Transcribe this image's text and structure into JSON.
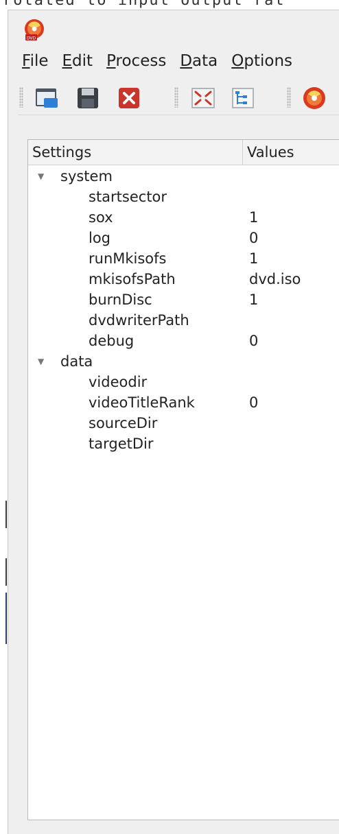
{
  "background_partial_text": "rotated to input output rat",
  "app": {
    "icon": "dvd-disc-icon",
    "icon_badge_text": "DVD"
  },
  "menubar": {
    "items": [
      {
        "label": "File"
      },
      {
        "label": "Edit"
      },
      {
        "label": "Process"
      },
      {
        "label": "Data"
      },
      {
        "label": "Options"
      }
    ]
  },
  "toolbar": {
    "buttons": [
      {
        "name": "open-window-icon"
      },
      {
        "name": "save-icon"
      },
      {
        "name": "close-red-x-icon"
      },
      {
        "name": "expand-tree-icon"
      },
      {
        "name": "collapse-tree-icon"
      },
      {
        "name": "burn-disc-icon"
      }
    ]
  },
  "tree": {
    "headers": {
      "settings": "Settings",
      "values": "Values"
    },
    "groups": [
      {
        "label": "system",
        "children": [
          {
            "key": "startsector",
            "value": ""
          },
          {
            "key": "sox",
            "value": "1"
          },
          {
            "key": "log",
            "value": "0"
          },
          {
            "key": "runMkisofs",
            "value": "1"
          },
          {
            "key": "mkisofsPath",
            "value": "dvd.iso"
          },
          {
            "key": "burnDisc",
            "value": "1"
          },
          {
            "key": "dvdwriterPath",
            "value": ""
          },
          {
            "key": "debug",
            "value": "0"
          }
        ]
      },
      {
        "label": "data",
        "children": [
          {
            "key": "videodir",
            "value": ""
          },
          {
            "key": "videoTitleRank",
            "value": "0"
          },
          {
            "key": "sourceDir",
            "value": ""
          },
          {
            "key": "targetDir",
            "value": ""
          }
        ]
      }
    ]
  },
  "colors": {
    "window_bg": "#efefef",
    "tree_bg": "#ffffff",
    "red_close": "#c9342b",
    "disc_red": "#d9391f"
  }
}
